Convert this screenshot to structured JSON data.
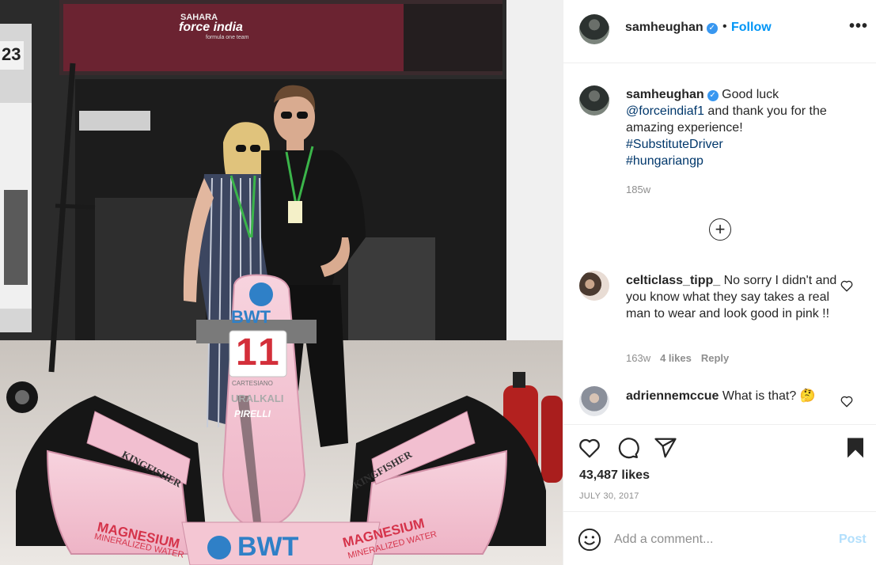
{
  "photo": {
    "garage_number": "23",
    "team_sign_line1": "SAHARA",
    "team_sign_line2": "force india",
    "team_sign_line3": "formula one team",
    "sponsor_bwt": "BWT",
    "car_number": "11",
    "sponsor_cartesiano": "CARTESIANO",
    "sponsor_uralkali": "URALKALI",
    "sponsor_pirelli": "PIRELLI",
    "sponsor_kingfisher_left": "KINGFISHER",
    "sponsor_kingfisher_right": "KINGFISHER",
    "magnesium_left_1": "MAGNESIUM",
    "magnesium_left_2": "MINERALIZED WATER",
    "magnesium_right_1": "MAGNESIUM",
    "magnesium_right_2": "MINERALIZED WATER",
    "sponsor_bwt_bottom": "BWT"
  },
  "header": {
    "username": "samheughan",
    "dot": "•",
    "follow_label": "Follow",
    "more_label": "•••"
  },
  "caption": {
    "username": "samheughan",
    "text1": "Good luck",
    "mention": "@forceindiaf1",
    "text2": "and thank you for the amazing experience!",
    "hashtag1": "#SubstituteDriver",
    "hashtag2": "#hungariangp",
    "time": "185w"
  },
  "load_more_label": "+",
  "comments": [
    {
      "username": "celticlass_tipp_",
      "text": "No sorry I didn't and you know what they say takes a real man to wear and look good in pink !!",
      "time": "163w",
      "likes": "4 likes",
      "reply": "Reply"
    },
    {
      "username": "adriennemccue",
      "text": "What is that?",
      "emoji": "🤔"
    }
  ],
  "actions": {
    "likes": "43,487 likes",
    "date": "JULY 30, 2017"
  },
  "add_comment": {
    "placeholder": "Add a comment...",
    "post_label": "Post"
  },
  "colors": {
    "accent": "#0095f6",
    "link": "#00376b",
    "muted": "#8e8e8e",
    "post_disabled": "#b2dffc",
    "verified": "#3897f0",
    "car_pink": "#f4c6d3"
  },
  "icons": [
    "more-icon",
    "verified-icon",
    "load-more-icon",
    "heart-icon",
    "comment-icon",
    "share-icon",
    "bookmark-icon",
    "emoji-icon"
  ]
}
